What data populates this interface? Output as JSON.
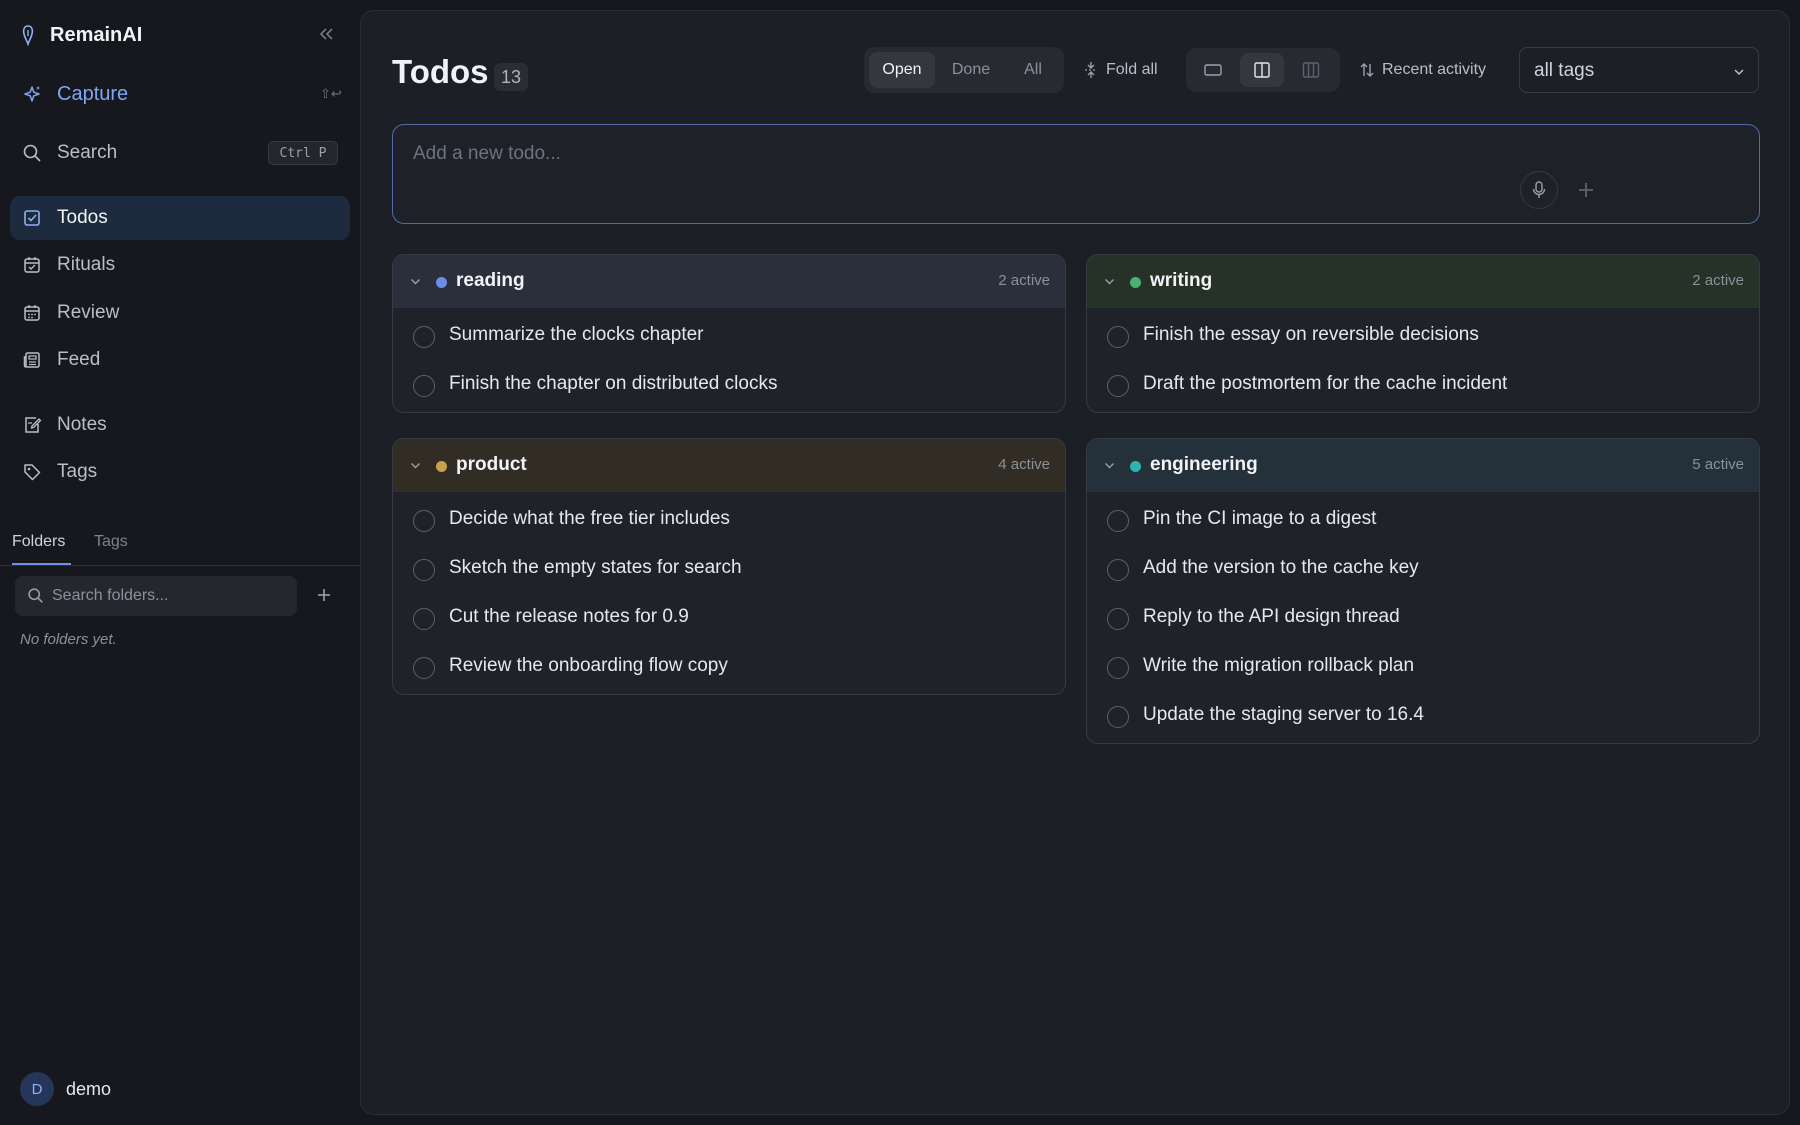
{
  "app": {
    "name": "RemainAI"
  },
  "sidebar": {
    "capture": {
      "label": "Capture",
      "shortcut": "⇧↩"
    },
    "search": {
      "label": "Search",
      "shortcut": "Ctrl P"
    },
    "items": [
      {
        "label": "Todos",
        "icon": "checkbox-icon",
        "active": true
      },
      {
        "label": "Rituals",
        "icon": "calendar-check-icon"
      },
      {
        "label": "Review",
        "icon": "calendar-icon"
      },
      {
        "label": "Feed",
        "icon": "newspaper-icon"
      },
      {
        "label": "Notes",
        "icon": "note-edit-icon"
      },
      {
        "label": "Tags",
        "icon": "tag-icon"
      }
    ],
    "tabs": {
      "folders": "Folders",
      "tags": "Tags"
    },
    "folder_search_placeholder": "Search folders...",
    "empty_folders": "No folders yet.",
    "user": {
      "initial": "D",
      "name": "demo"
    }
  },
  "main": {
    "title": "Todos",
    "count": "13",
    "filters": {
      "open": "Open",
      "done": "Done",
      "all": "All",
      "selected": "Open"
    },
    "fold_all": "Fold all",
    "sort": "Recent activity",
    "tag_filter": "all tags",
    "composer_placeholder": "Add a new todo..."
  },
  "groups": [
    {
      "name": "reading",
      "active": "2 active",
      "color": "#6b8fe0",
      "head_bg": "#2a2f3b",
      "todos": [
        "Summarize the clocks chapter",
        "Finish the chapter on distributed clocks"
      ]
    },
    {
      "name": "writing",
      "active": "2 active",
      "color": "#4cb072",
      "head_bg": "#263128",
      "todos": [
        "Finish the essay on reversible decisions",
        "Draft the postmortem for the cache incident"
      ]
    },
    {
      "name": "product",
      "active": "4 active",
      "color": "#caa04a",
      "head_bg": "#312d25",
      "todos": [
        "Decide what the free tier includes",
        "Sketch the empty states for search",
        "Cut the release notes for 0.9",
        "Review the onboarding flow copy"
      ]
    },
    {
      "name": "engineering",
      "active": "5 active",
      "color": "#2fb3b3",
      "head_bg": "#24313a",
      "todos": [
        "Pin the CI image to a digest",
        "Add the version to the cache key",
        "Reply to the API design thread",
        "Write the migration rollback plan",
        "Update the staging server to 16.4"
      ]
    }
  ]
}
